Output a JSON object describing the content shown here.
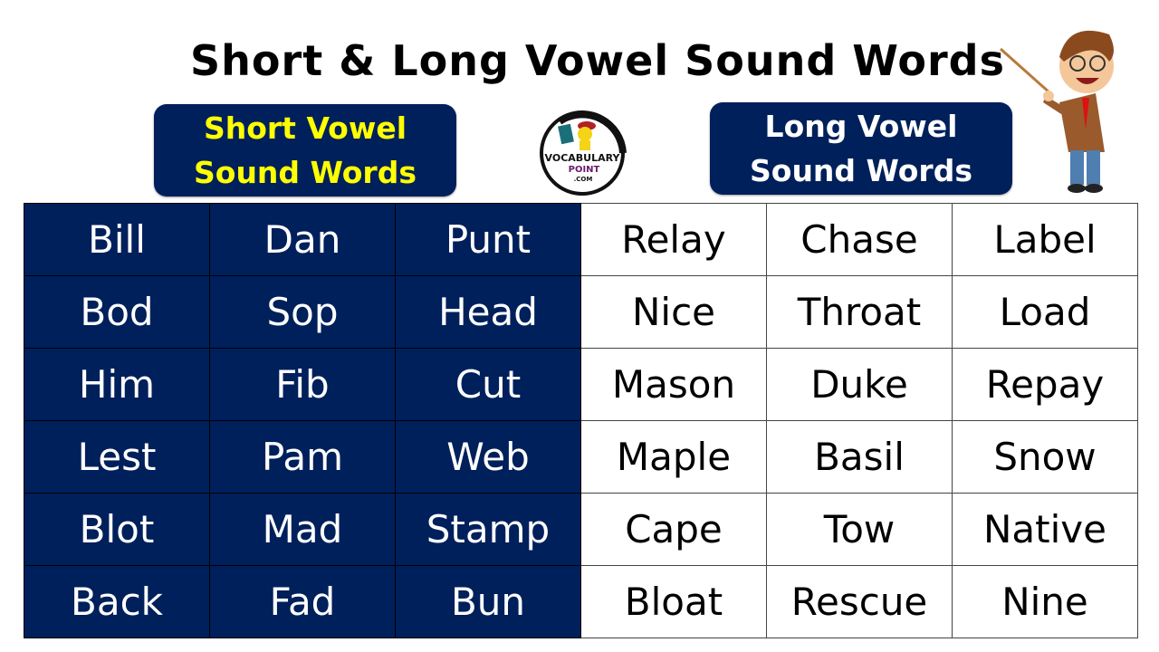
{
  "title": "Short & Long Vowel Sound Words",
  "headers": {
    "short": [
      "Short Vowel",
      "Sound Words"
    ],
    "long": [
      "Long Vowel",
      "Sound Words"
    ]
  },
  "logo": {
    "line1": "VOCABULARY",
    "line2": "POINT",
    "line3": ".COM"
  },
  "colors": {
    "navy": "#00205b",
    "yellow": "#ffff00"
  },
  "rows": [
    {
      "short": [
        "Bill",
        "Dan",
        "Punt"
      ],
      "long": [
        "Relay",
        "Chase",
        "Label"
      ]
    },
    {
      "short": [
        "Bod",
        "Sop",
        "Head"
      ],
      "long": [
        "Nice",
        "Throat",
        "Load"
      ]
    },
    {
      "short": [
        "Him",
        "Fib",
        "Cut"
      ],
      "long": [
        "Mason",
        "Duke",
        "Repay"
      ]
    },
    {
      "short": [
        "Lest",
        "Pam",
        "Web"
      ],
      "long": [
        "Maple",
        "Basil",
        "Snow"
      ]
    },
    {
      "short": [
        "Blot",
        "Mad",
        "Stamp"
      ],
      "long": [
        "Cape",
        "Tow",
        "Native"
      ]
    },
    {
      "short": [
        "Back",
        "Fad",
        "Bun"
      ],
      "long": [
        "Bloat",
        "Rescue",
        "Nine"
      ]
    }
  ]
}
